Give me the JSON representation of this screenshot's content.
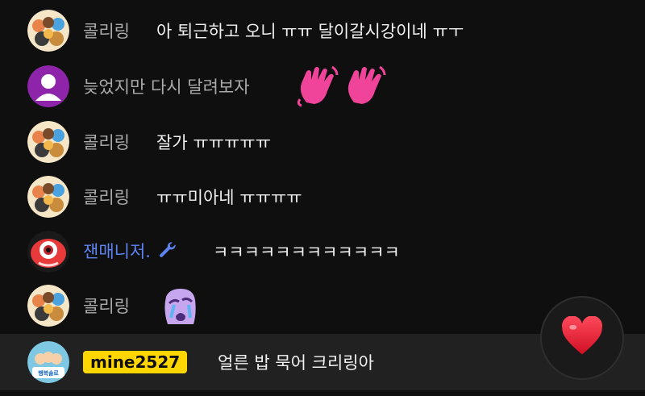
{
  "messages": [
    {
      "author": "콜리링",
      "text": "아 퇴근하고 오니 ㅠㅠ 달이갈시강이네 ㅠㅜ"
    },
    {
      "author": "늦었지만 다시 달려보자",
      "text": ""
    },
    {
      "author": "콜리링",
      "text": "잘가 ㅠㅠㅠㅠㅠ"
    },
    {
      "author": "콜리링",
      "text": "ㅠㅠ미아네 ㅠㅠㅠㅠ"
    },
    {
      "author": "잰매니저.",
      "text": "ㅋㅋㅋㅋㅋㅋㅋㅋㅋㅋㅋㅋ"
    },
    {
      "author": "콜리링",
      "text": ""
    },
    {
      "author": "mine2527",
      "text": "얼른 밥 묵어 크리링아"
    }
  ],
  "avatar_badge_text": "행복솔로 솔로3일째",
  "colors": {
    "background": "#0f0f0f",
    "author_gray": "#aaaaaa",
    "moderator_blue": "#5e84f1",
    "member_badge": "#ffd600",
    "highlight_row": "#212121",
    "heart": "#e5122b"
  },
  "icons": {
    "moderator": "wrench-icon",
    "reaction": "heart-icon",
    "waving_hands": "waving-hand-emoji",
    "crying_face": "crying-face-emoji"
  }
}
